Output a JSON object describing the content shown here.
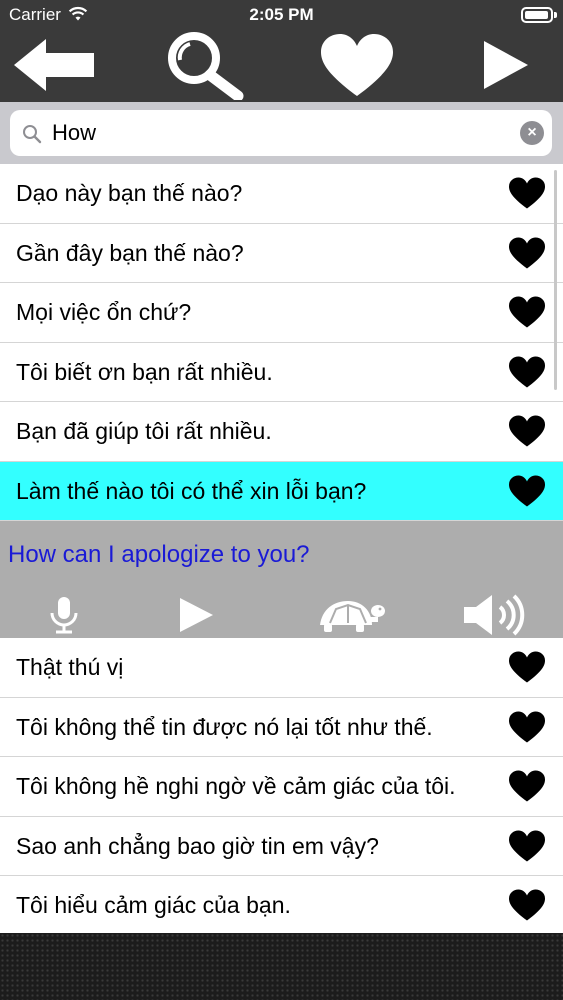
{
  "status_bar": {
    "carrier": "Carrier",
    "time": "2:05 PM"
  },
  "toolbar": {
    "back_icon": "left-arrow-icon",
    "search_icon": "magnifier-icon",
    "favorites_icon": "heart-icon",
    "play_icon": "play-icon"
  },
  "search": {
    "value": "How",
    "placeholder": ""
  },
  "rows_top": [
    {
      "text": "Dạo này bạn thế nào?"
    },
    {
      "text": "Gần đây bạn thế nào?"
    },
    {
      "text": "Mọi việc ổn chứ?"
    },
    {
      "text": "Tôi biết ơn bạn rất nhiều."
    },
    {
      "text": "Bạn đã giúp tôi rất nhiều."
    }
  ],
  "selected_row": {
    "text": "Làm thế nào tôi có thể xin lỗi bạn?"
  },
  "detail": {
    "translation": "How can I apologize to you?",
    "controls": [
      "microphone-icon",
      "play-icon",
      "turtle-icon",
      "speaker-icon"
    ]
  },
  "rows_bottom": [
    {
      "text": "Thật thú vị"
    },
    {
      "text": "Tôi không thể tin được nó lại tốt như thế."
    },
    {
      "text": "Tôi không hề nghi ngờ về cảm giác của tôi."
    },
    {
      "text": "Sao anh chẳng bao giờ tin em vậy?"
    },
    {
      "text": "Tôi hiểu cảm giác của bạn."
    }
  ],
  "colors": {
    "toolbar_bg": "#3a3a3a",
    "selected_bg": "#33ffff",
    "detail_bg": "#adadad",
    "translation_text": "#1a1ad6"
  }
}
